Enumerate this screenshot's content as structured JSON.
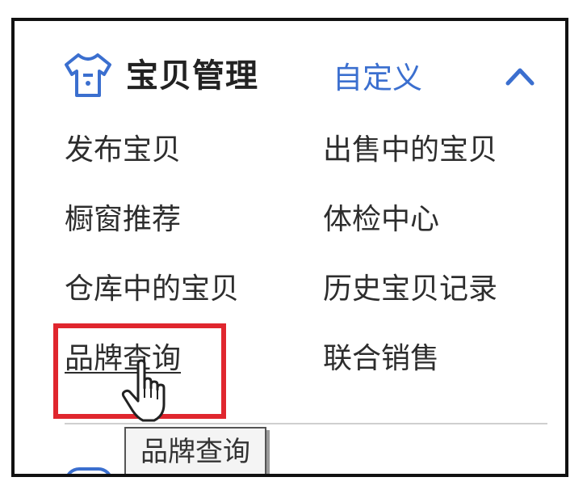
{
  "header": {
    "icon": "shirt-icon",
    "title": "宝贝管理",
    "customize_label": "自定义",
    "collapse_icon": "chevron-up-icon"
  },
  "menu": {
    "items": [
      {
        "label": "发布宝贝"
      },
      {
        "label": "出售中的宝贝"
      },
      {
        "label": "橱窗推荐"
      },
      {
        "label": "体检中心"
      },
      {
        "label": "仓库中的宝贝"
      },
      {
        "label": "历史宝贝记录"
      },
      {
        "label": "品牌查询"
      },
      {
        "label": "联合销售"
      }
    ]
  },
  "tooltip": {
    "text": "品牌查询"
  },
  "colors": {
    "link": "#3b6fcf",
    "highlight": "#e0262e",
    "text": "#2d2d2d"
  },
  "cursor": "hand-pointer-icon"
}
